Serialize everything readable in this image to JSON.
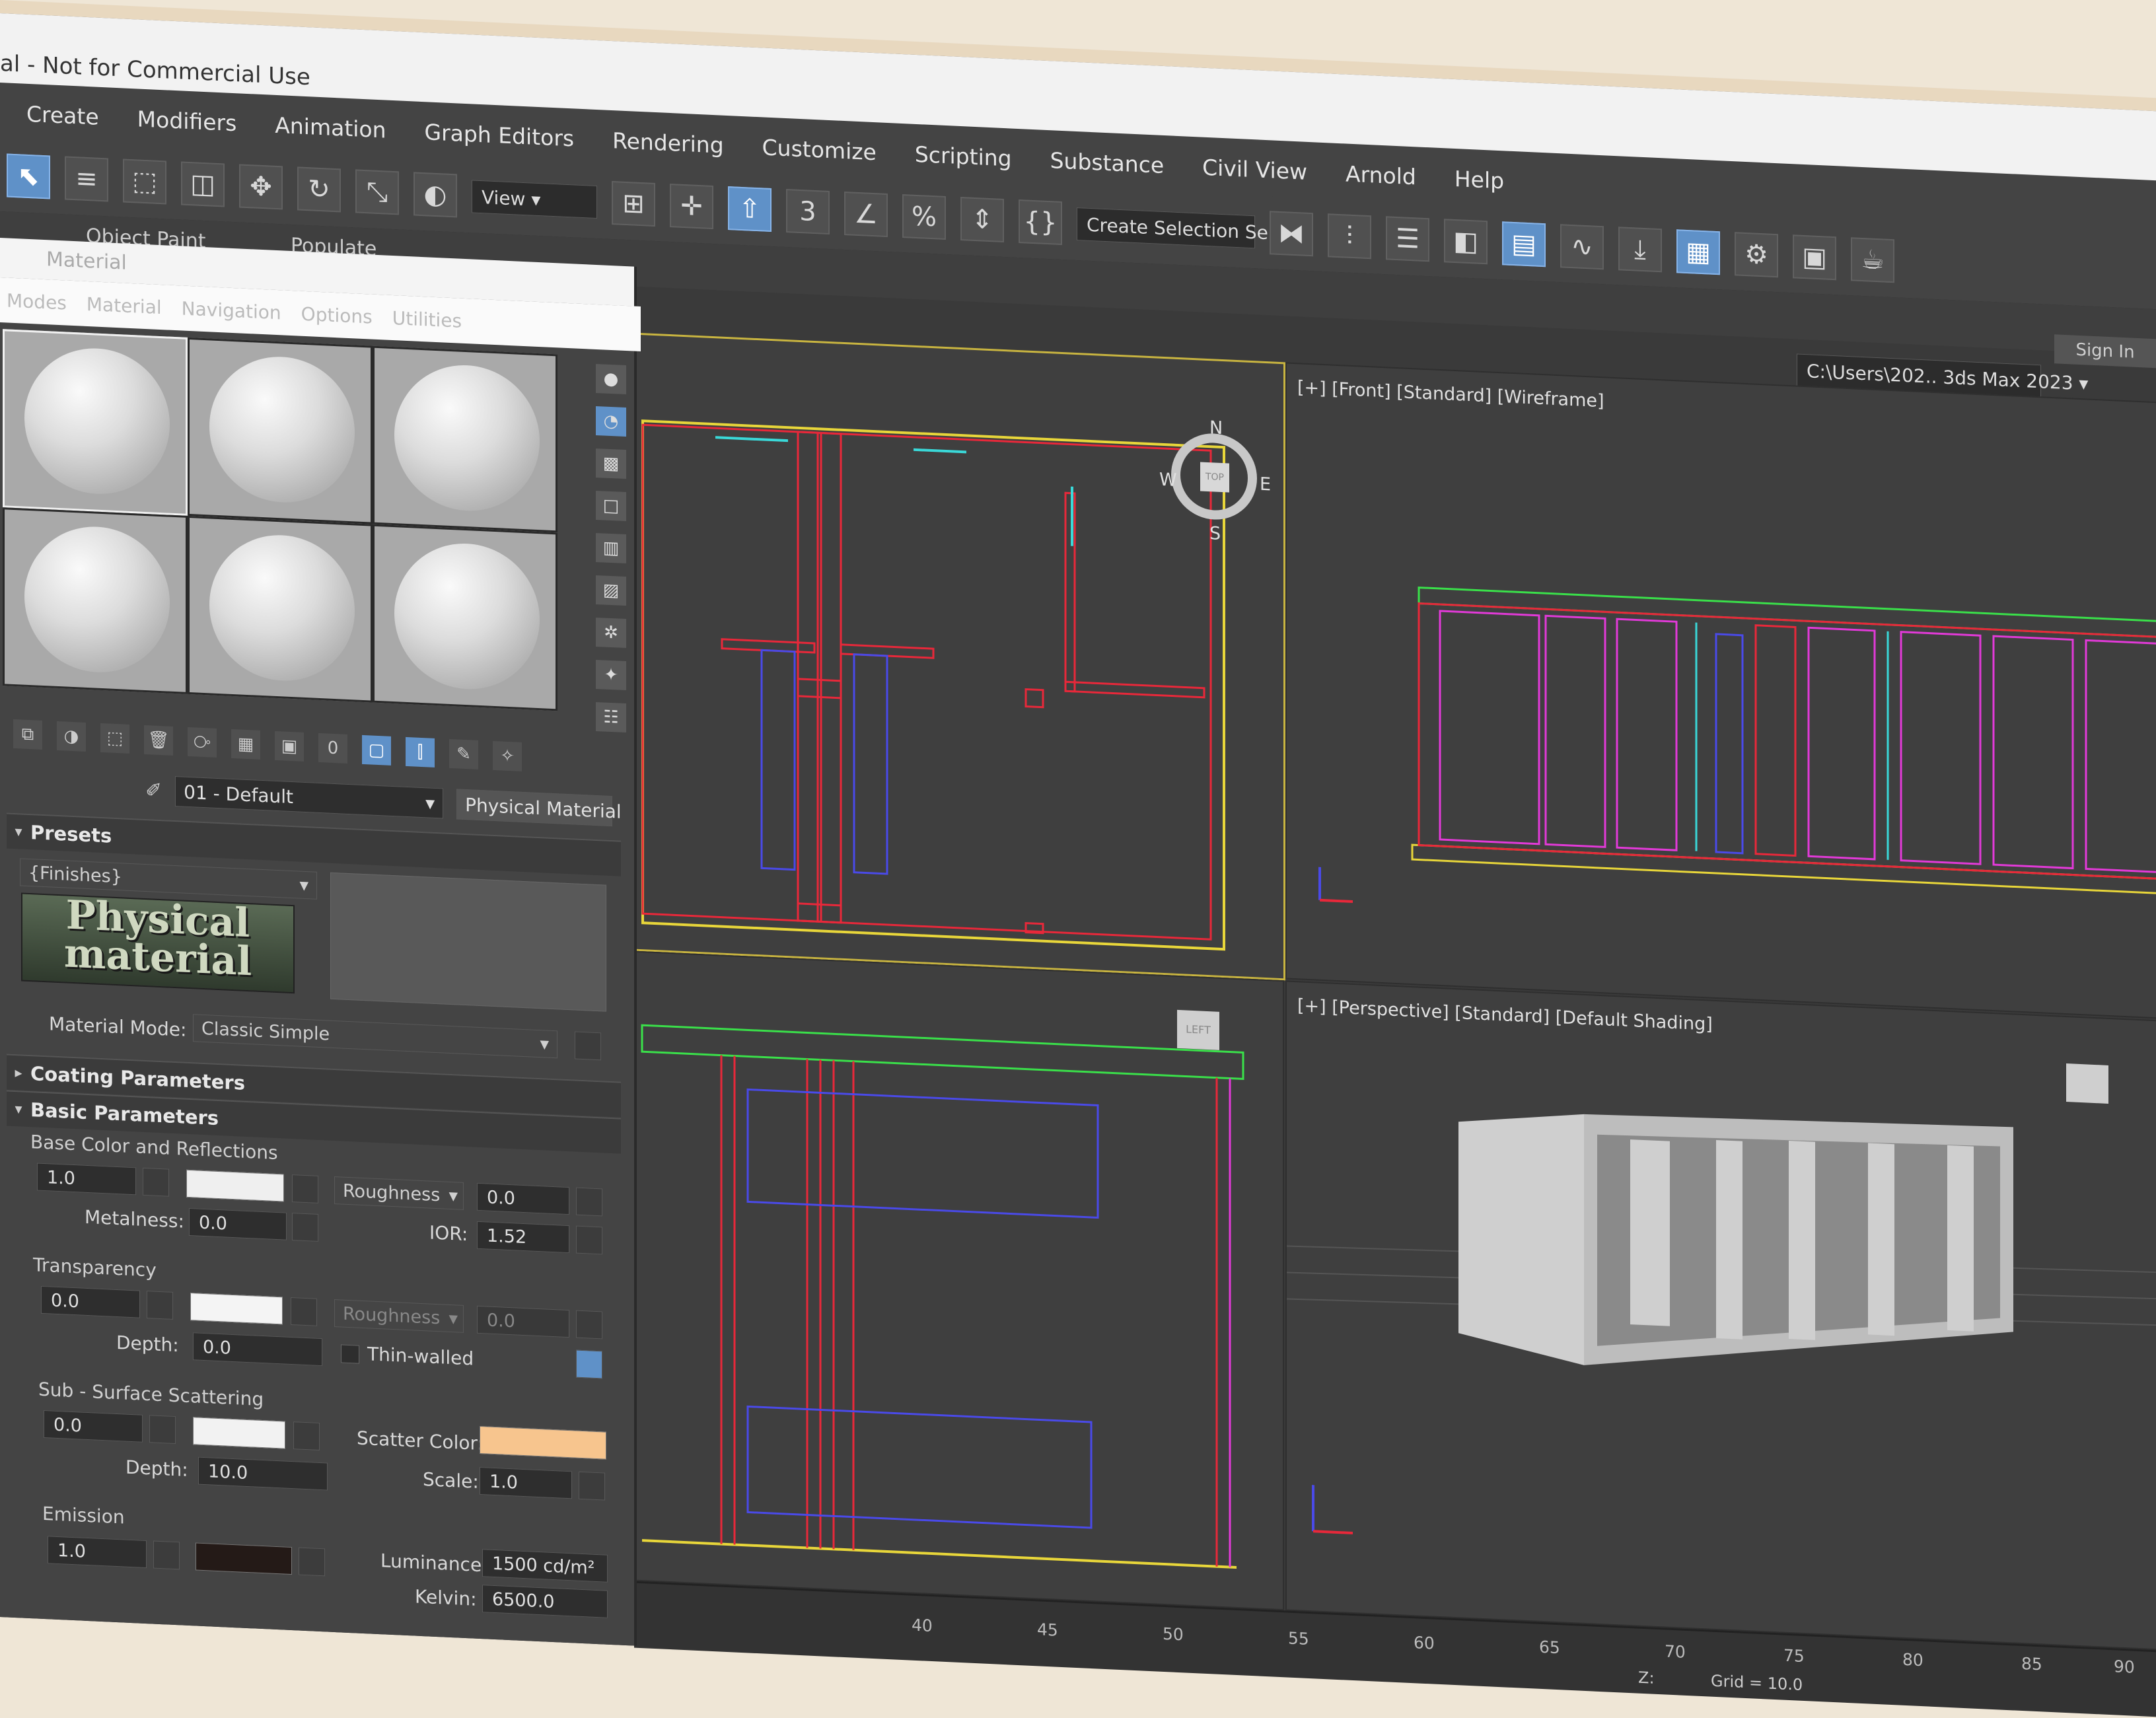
{
  "title": "al - Not for Commercial Use",
  "menu": [
    "Create",
    "Modifiers",
    "Animation",
    "Graph Editors",
    "Rendering",
    "Customize",
    "Scripting",
    "Substance",
    "Civil View",
    "Arnold",
    "Help"
  ],
  "toolbar": {
    "view_combo": "View",
    "selection_set": "Create Selection Se"
  },
  "ribbon": {
    "object_paint": "Object Paint",
    "populate": "Populate"
  },
  "path": "C:\\Users\\202.. 3ds Max 2023",
  "sign_in": "Sign In",
  "material_editor": {
    "title": "Material",
    "menu": [
      "Modes",
      "Material",
      "Navigation",
      "Options",
      "Utilities"
    ],
    "material_name": "01 - Default",
    "material_type": "Physical Material",
    "presets": {
      "label": "Presets",
      "value": "{Finishes}",
      "logo_line1": "Physical",
      "logo_line2": "material"
    },
    "material_mode": {
      "label": "Material Mode:",
      "value": "Classic Simple"
    },
    "coating": "Coating Parameters",
    "basic": "Basic Parameters",
    "base": {
      "section": "Base Color and Reflections",
      "weight": "1.0",
      "roughness_label": "Roughness",
      "roughness": "0.0",
      "metalness_label": "Metalness:",
      "metalness": "0.0",
      "ior_label": "IOR:",
      "ior": "1.52"
    },
    "transparency": {
      "section": "Transparency",
      "weight": "0.0",
      "roughness_label": "Roughness",
      "roughness": "0.0",
      "depth_label": "Depth:",
      "depth": "0.0",
      "thin_walled": "Thin-walled"
    },
    "sss": {
      "section": "Sub - Surface Scattering",
      "weight": "0.0",
      "scatter_label": "Scatter Color:",
      "depth_label": "Depth:",
      "depth": "10.0",
      "scale_label": "Scale:",
      "scale": "1.0"
    },
    "emission": {
      "section": "Emission",
      "weight": "1.0",
      "luminance_label": "Luminance:",
      "luminance": "1500 cd/m²",
      "kelvin_label": "Kelvin:",
      "kelvin": "6500.0"
    }
  },
  "viewports": {
    "front": "[+] [Front] [Standard] [Wireframe]",
    "perspective": "[+] [Perspective] [Standard] [Default Shading]",
    "top_cube": "TOP",
    "left_cube": "LEFT",
    "compass": {
      "n": "N",
      "s": "S",
      "e": "E",
      "w": "W"
    }
  },
  "timeline": {
    "ticks": [
      "40",
      "45",
      "50",
      "55",
      "60",
      "65",
      "70",
      "75",
      "80",
      "85",
      "90"
    ],
    "grid": "Grid = 10.0",
    "z_label": "Z:"
  },
  "colors": {
    "red": "#e8283a",
    "yellow": "#e8d63a",
    "green": "#3ae04a",
    "magenta": "#e23ad8",
    "blue": "#4a4ae8",
    "cyan": "#3ad8d8",
    "scatter": "#f7c58e",
    "active": "#5f91c8"
  }
}
